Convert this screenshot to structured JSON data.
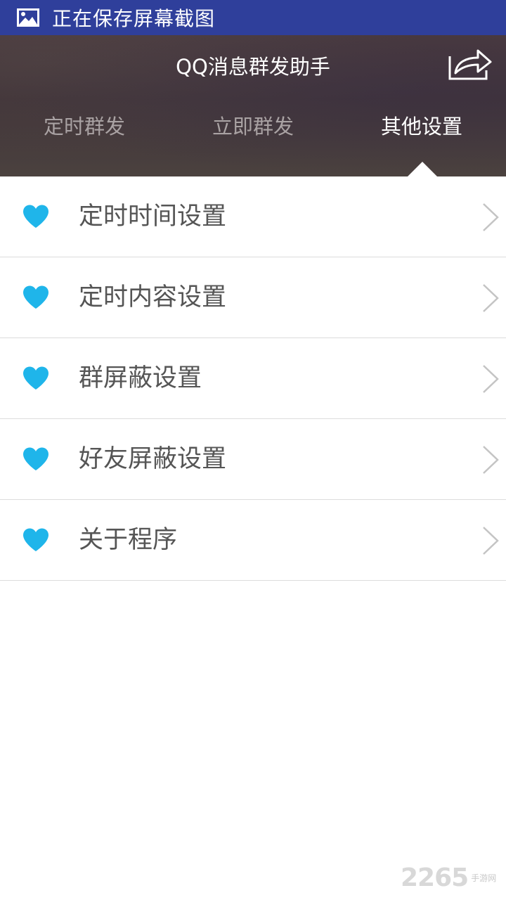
{
  "statusbar": {
    "icon": "image-icon",
    "text": "正在保存屏幕截图"
  },
  "header": {
    "title": "QQ消息群发助手",
    "share_icon": "share-icon",
    "tabs": [
      {
        "label": "定时群发",
        "active": false
      },
      {
        "label": "立即群发",
        "active": false
      },
      {
        "label": "其他设置",
        "active": true
      }
    ]
  },
  "menu": {
    "items": [
      {
        "label": "定时时间设置",
        "icon": "heart-icon",
        "arrow": "chevron-right-icon"
      },
      {
        "label": "定时内容设置",
        "icon": "heart-icon",
        "arrow": "chevron-right-icon"
      },
      {
        "label": "群屏蔽设置",
        "icon": "heart-icon",
        "arrow": "chevron-right-icon"
      },
      {
        "label": "好友屏蔽设置",
        "icon": "heart-icon",
        "arrow": "chevron-right-icon"
      },
      {
        "label": "关于程序",
        "icon": "heart-icon",
        "arrow": "chevron-right-icon"
      }
    ]
  },
  "watermark": {
    "number": "2265",
    "suffix": "手游网"
  },
  "colors": {
    "statusbar_bg": "#2f3f9b",
    "accent_heart": "#1fb5ea",
    "divider": "#dcdcdc"
  }
}
